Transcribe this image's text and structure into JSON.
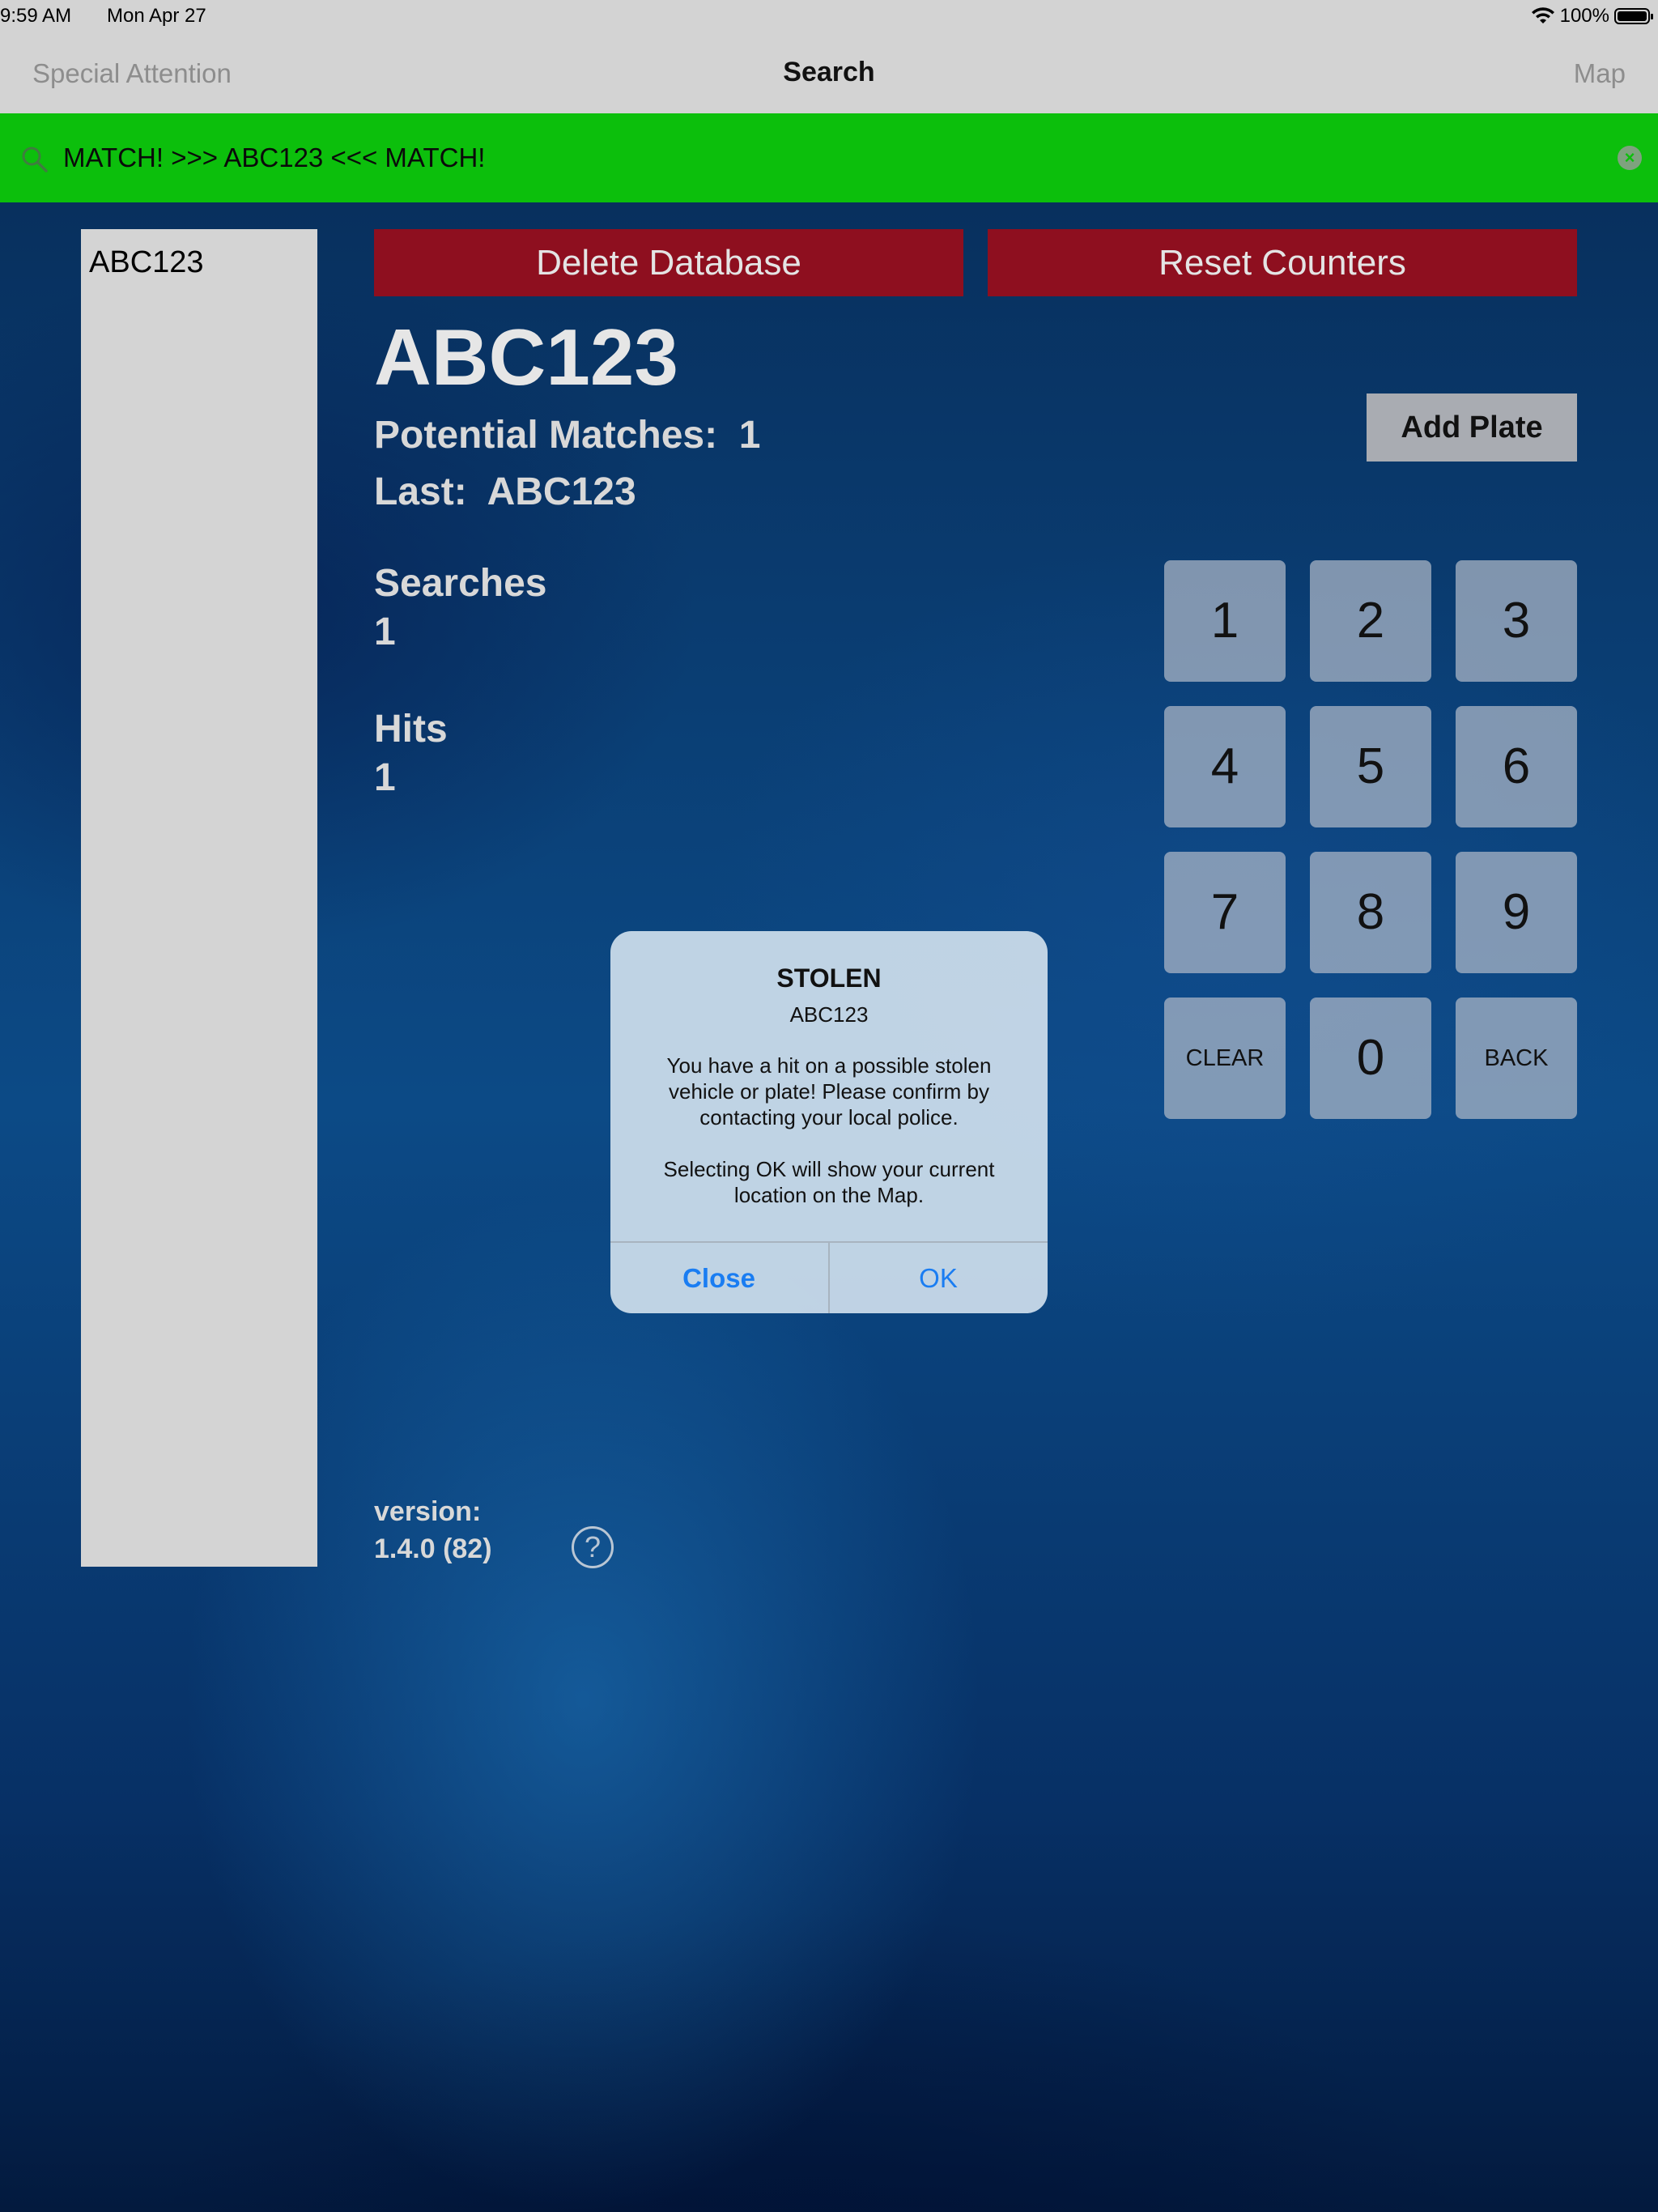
{
  "status_bar": {
    "time": "9:59 AM",
    "date": "Mon Apr 27",
    "battery": "100%"
  },
  "nav": {
    "left": "Special Attention",
    "title": "Search",
    "right": "Map"
  },
  "search": {
    "text": "MATCH! >>> ABC123 <<< MATCH!",
    "bar_color": "#0cbf0c"
  },
  "plate_list": {
    "items": [
      "ABC123"
    ]
  },
  "buttons": {
    "delete_database": "Delete Database",
    "reset_counters": "Reset Counters",
    "add_plate": "Add Plate",
    "accent_red": "#8e0f1f"
  },
  "current_plate": "ABC123",
  "stats": {
    "potential_matches_label": "Potential Matches:",
    "potential_matches_value": "1",
    "last_label": "Last:",
    "last_value": "ABC123",
    "searches_label": "Searches",
    "searches_value": "1",
    "hits_label": "Hits",
    "hits_value": "1"
  },
  "keypad": {
    "keys": [
      "1",
      "2",
      "3",
      "4",
      "5",
      "6",
      "7",
      "8",
      "9",
      "CLEAR",
      "0",
      "BACK"
    ]
  },
  "version": {
    "label": "version:",
    "value": "1.4.0 (82)",
    "help_glyph": "?"
  },
  "dialog": {
    "title": "STOLEN",
    "subtitle": "ABC123",
    "message": "You have a hit on a possible stolen vehicle or plate! Please confirm by contacting your local police.",
    "message2": "Selecting OK will show your current location on the Map.",
    "close": "Close",
    "ok": "OK",
    "button_color": "#1a7df2"
  }
}
